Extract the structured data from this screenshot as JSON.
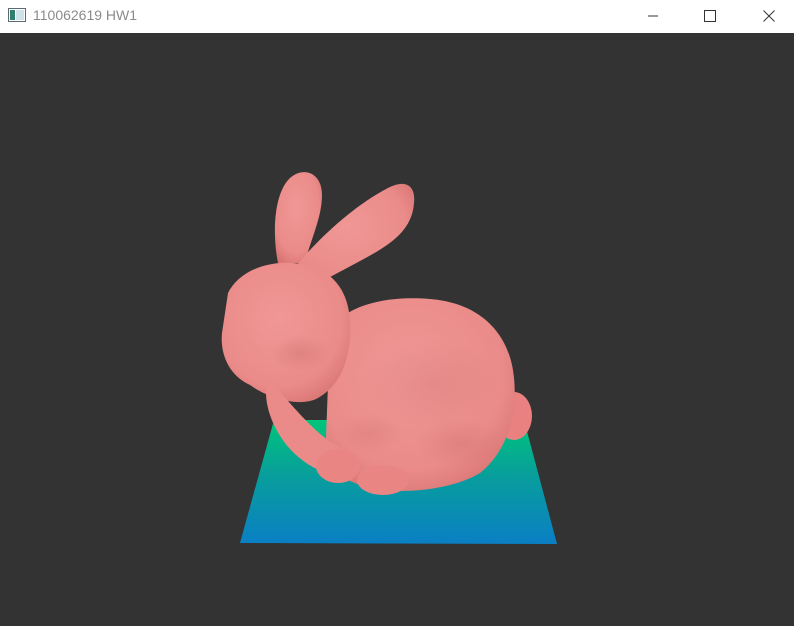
{
  "window": {
    "title": "110062619 HW1",
    "icons": {
      "app": "app-window-icon",
      "minimize": "minimize-icon",
      "maximize": "maximize-icon",
      "close": "close-icon"
    }
  },
  "viewport": {
    "background": "#333333",
    "objects": {
      "model": "stanford-bunny",
      "model_color": "#ea8b89",
      "plane_gradient": [
        "#00c57a",
        "#0a7fc4"
      ]
    }
  }
}
